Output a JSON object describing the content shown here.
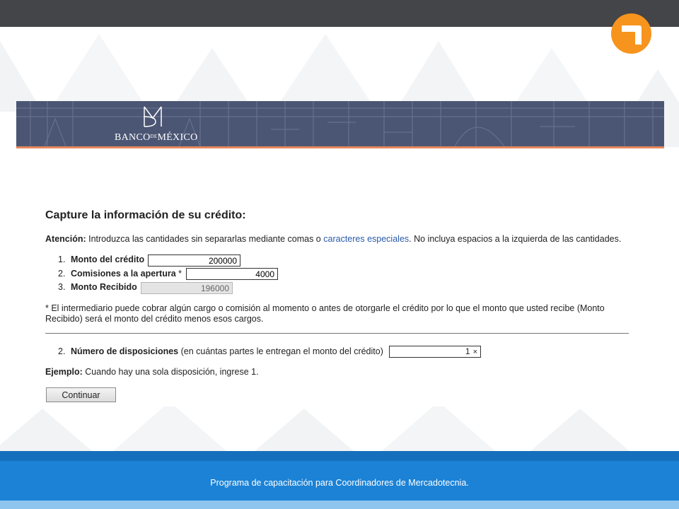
{
  "bank": {
    "name_part1": "BANCO",
    "name_small": "DE",
    "name_part2": "MÉXICO"
  },
  "form": {
    "title": "Capture la información de su crédito:",
    "note_label": "Atención:",
    "note_text_1": " Introduzca las cantidades sin separarlas mediante comas o ",
    "note_link": "caracteres especiales",
    "note_text_2": ". No incluya espacios a la izquierda de las cantidades.",
    "items": [
      {
        "number": "1.",
        "label": "Monto del crédito",
        "suffix": "",
        "value": "200000"
      },
      {
        "number": "2.",
        "label": "Comisiones a la apertura",
        "suffix": " *",
        "value": "4000"
      },
      {
        "number": "3.",
        "label": "Monto Recibido",
        "suffix": "",
        "value": "196000"
      }
    ],
    "footnote": "* El intermediario puede cobrar algún cargo o comisión al momento o antes de otorgarle el crédito por lo que el monto que usted recibe (Monto Recibido) será el monto del crédito menos esos cargos.",
    "disposiciones": {
      "number": "2.",
      "label": "Número de disposiciones",
      "hint": " (en cuántas partes le entregan el monto del crédito)",
      "value": "1",
      "clear_glyph": "×"
    },
    "example_label": "Ejemplo:",
    "example_text": " Cuando hay una sola disposición, ingrese 1.",
    "continue_label": "Continuar"
  },
  "footer": {
    "text": "Programa de capacitación para Coordinadores de Mercadotecnia."
  },
  "colors": {
    "topbar": "#444548",
    "brand_orange": "#f7941d",
    "banner": "#4b5674",
    "link": "#2a5aa8",
    "footer": "#1b82d6"
  },
  "icons": {
    "logo": "orange-circle-seven-icon",
    "bank_logo": "bank-monogram-icon"
  }
}
